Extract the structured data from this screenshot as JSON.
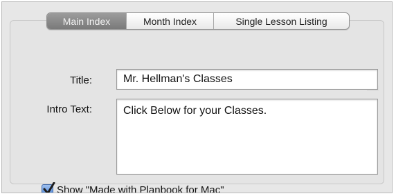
{
  "tabs": {
    "items": [
      {
        "label": "Main Index",
        "selected": true
      },
      {
        "label": "Month Index",
        "selected": false
      },
      {
        "label": "Single Lesson Listing",
        "selected": false
      }
    ]
  },
  "form": {
    "title_label": "Title:",
    "title_value": "Mr. Hellman's Classes",
    "intro_label": "Intro Text:",
    "intro_value": "Click Below for your Classes.",
    "show_made_with_label": "Show \"Made with Planbook for Mac\"",
    "show_made_with_checked": true
  },
  "colors": {
    "selected_tab": "#878787",
    "checkbox_accent": "#4c84d6",
    "panel_background": "#e7e7e7"
  },
  "icons": {
    "checkbox": "checkmark-icon"
  }
}
